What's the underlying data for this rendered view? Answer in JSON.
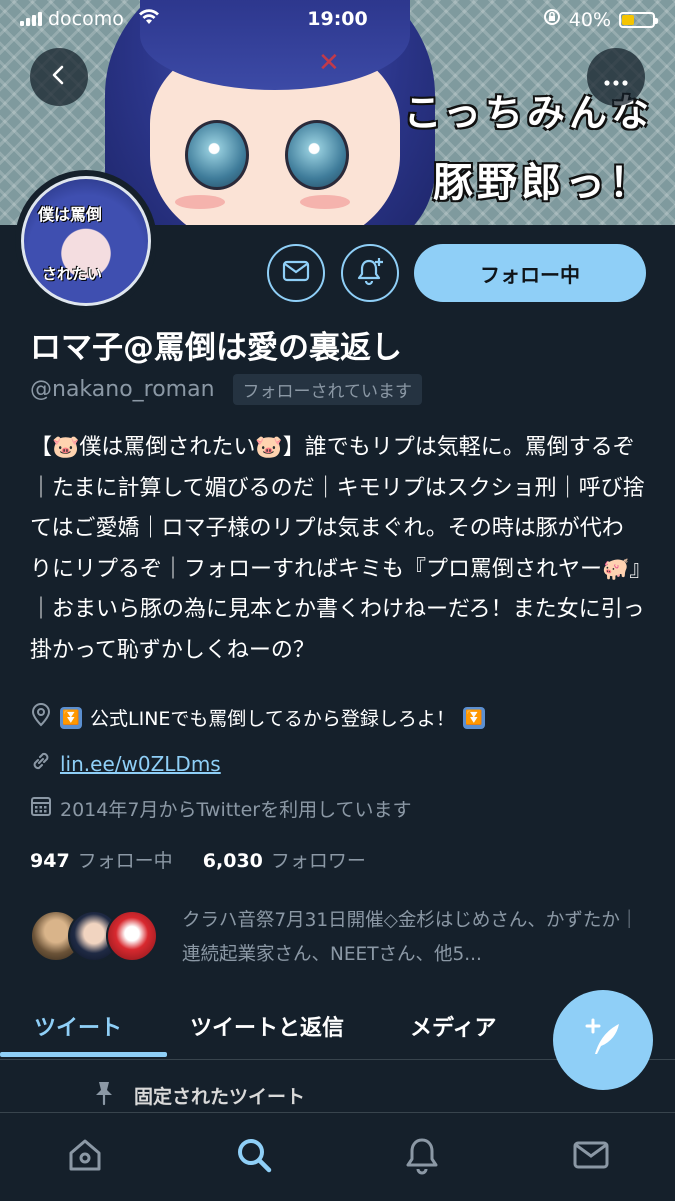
{
  "status_bar": {
    "carrier": "docomo",
    "time": "19:00",
    "battery": "40%",
    "battery_level": 0.4
  },
  "banner": {
    "line1": "こっちみんな",
    "line2": "豚野郎っ！"
  },
  "avatar": {
    "line1": "僕は罵倒",
    "line2": "されたい"
  },
  "actions": {
    "follow_label": "フォロー中"
  },
  "profile": {
    "display_name": "ロマ子@罵倒は愛の裏返し",
    "handle": "@nakano_roman",
    "follows_you": "フォローされています",
    "bio": "【🐷僕は罵倒されたい🐷】誰でもリプは気軽に。罵倒するぞ｜たまに計算して媚びるのだ｜キモリプはスクショ刑｜呼び捨てはご愛嬌｜ロマ子様のリプは気まぐれ。その時は豚が代わりにリプるぞ｜フォローすればキミも『プロ罵倒されヤー🐖』｜おまいら豚の為に見本とか書くわけねーだろ！また女に引っ掛かって恥ずかしくねーの？",
    "location": "公式LINEでも罵倒してるから登録しろよ！",
    "location_badge": "⏬",
    "link": "lin.ee/w0ZLDms",
    "joined": "2014年7月からTwitterを利用しています",
    "following_count": "947",
    "following_label": "フォロー中",
    "followers_count": "6,030",
    "followers_label": "フォロワー",
    "known_followers": "クラハ音祭7月31日開催◇金杉はじめさん、かずたか｜連続起業家さん、NEETさん、他5..."
  },
  "tabs": [
    {
      "label": "ツイート",
      "active": true
    },
    {
      "label": "ツイートと返信",
      "active": false
    },
    {
      "label": "メディア",
      "active": false
    }
  ],
  "pinned_label": "固定されたツイート",
  "icons": {
    "back": "chevron-left-icon",
    "more": "more-horizontal-icon",
    "mail": "mail-icon",
    "notify": "bell-plus-icon",
    "location": "location-pin-icon",
    "link": "link-icon",
    "calendar": "calendar-icon",
    "pin": "pin-icon",
    "compose": "compose-feather-icon",
    "home": "home-icon",
    "search": "search-icon",
    "notifications": "bell-icon",
    "messages": "envelope-icon"
  },
  "colors": {
    "background": "#15202b",
    "accent": "#8fcff7",
    "secondary_text": "#8b98a5"
  }
}
